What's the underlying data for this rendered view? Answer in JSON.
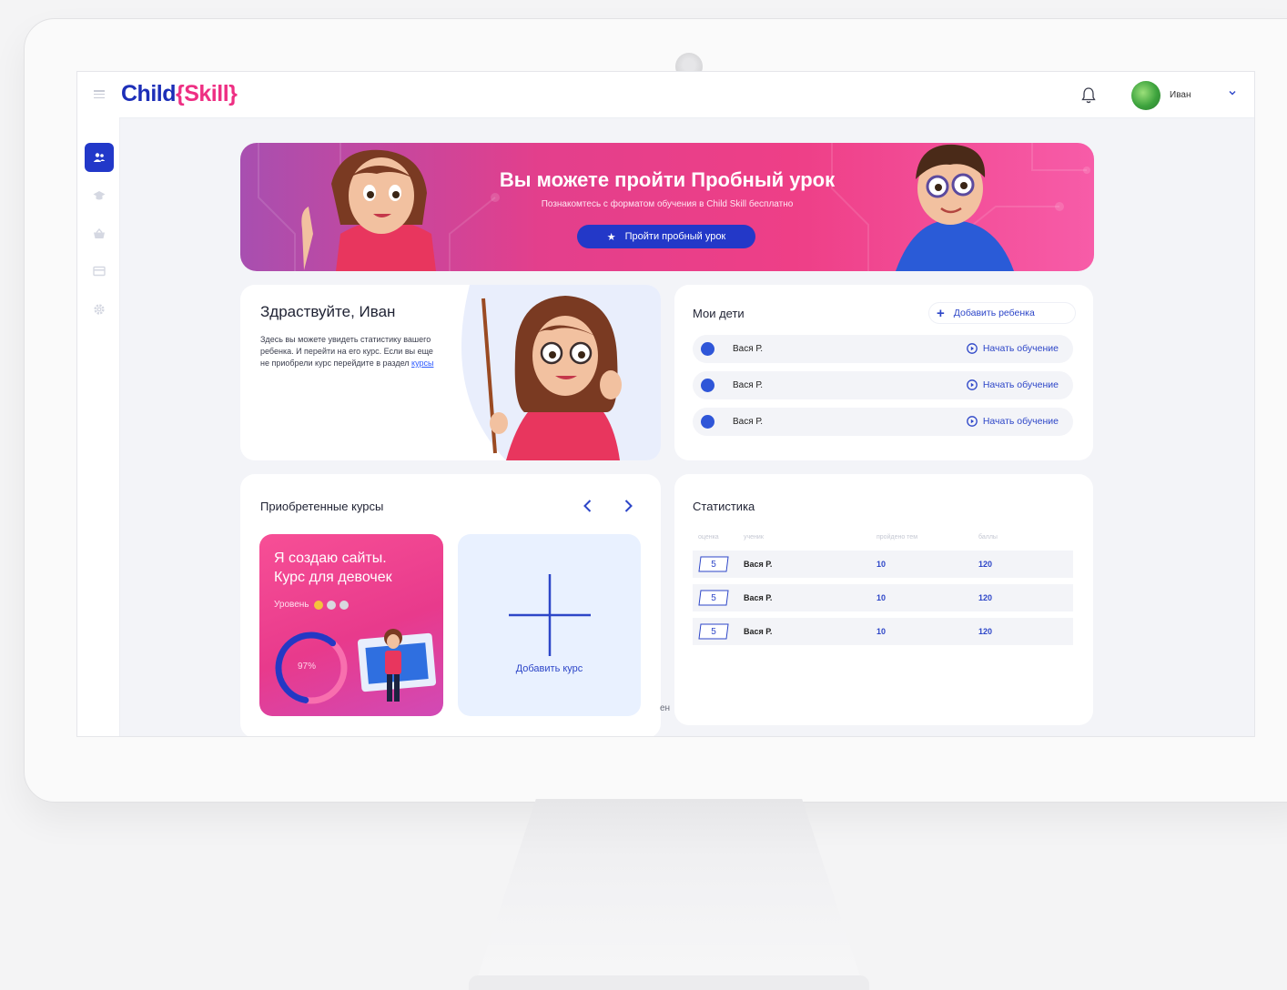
{
  "app": {
    "logo_part1": "Child",
    "logo_part2": "{Skill}",
    "user_name": "Иван"
  },
  "banner": {
    "title": "Вы можете пройти Пробный урок",
    "subtitle": "Познакомтесь с форматом обучения в Child Skill бесплатно",
    "button_label": "Пройти пробный урок"
  },
  "greeting": {
    "title": "Здраствуйте, Иван",
    "text": "Здесь вы можете увидеть статистику вашего ребенка. И перейти на его курс. Если вы еще не приобрели курс перейдите в раздел ",
    "link_label": "курсы"
  },
  "children": {
    "title": "Мои дети",
    "add_label": "Добавить ребенка",
    "items": [
      {
        "name": "Вася Р.",
        "action": "Начать обучение"
      },
      {
        "name": "Вася Р.",
        "action": "Начать обучение"
      },
      {
        "name": "Вася Р.",
        "action": "Начать обучение"
      }
    ]
  },
  "courses": {
    "title": "Приобретенные курсы",
    "items": [
      {
        "title_line1": "Я создаю сайты.",
        "title_line2": "Курс для девочек",
        "level_label": "Уровень",
        "level": 1,
        "level_max": 3,
        "progress_label": "97%",
        "progress": 0.97
      }
    ],
    "add_label": "Добавить курс",
    "stray_text": "ен"
  },
  "stats": {
    "title": "Статистика",
    "columns": [
      "оценка",
      "ученик",
      "пройдено тем",
      "баллы"
    ],
    "rows": [
      {
        "grade": "5",
        "name": "Вася Р.",
        "topics": "10",
        "points": "120"
      },
      {
        "grade": "5",
        "name": "Вася Р.",
        "topics": "10",
        "points": "120"
      },
      {
        "grade": "5",
        "name": "Вася Р.",
        "topics": "10",
        "points": "120"
      }
    ]
  },
  "colors": {
    "primary": "#2238c9",
    "accent": "#ee2f83",
    "background": "#f3f4f8",
    "level_active": "#f5c33b",
    "level_inactive": "#d8d8de"
  }
}
